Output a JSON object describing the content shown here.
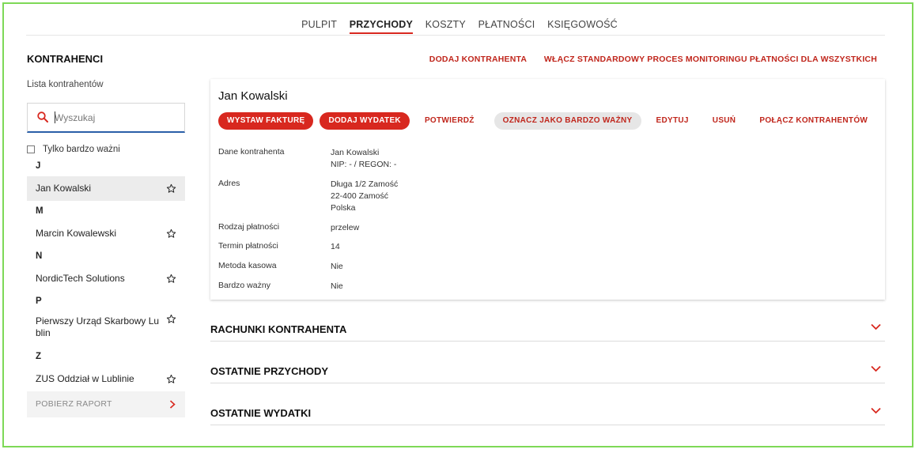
{
  "nav": {
    "tabs": [
      "PULPIT",
      "PRZYCHODY",
      "KOSZTY",
      "PŁATNOŚCI",
      "KSIĘGOWOŚĆ"
    ],
    "active": "PRZYCHODY"
  },
  "sidebar": {
    "title": "KONTRAHENCI",
    "list_label": "Lista kontrahentów",
    "search": {
      "placeholder": "Wyszukaj",
      "value": ""
    },
    "only_important_label": "Tylko bardzo ważni",
    "groups": [
      {
        "letter": "J",
        "items": [
          {
            "name": "Jan Kowalski",
            "selected": true
          }
        ]
      },
      {
        "letter": "M",
        "items": [
          {
            "name": "Marcin Kowalewski"
          }
        ]
      },
      {
        "letter": "N",
        "items": [
          {
            "name": "NordicTech Solutions"
          }
        ]
      },
      {
        "letter": "P",
        "items": [
          {
            "name": "Pierwszy Urząd Skarbowy Lublin",
            "wrap": true
          }
        ]
      },
      {
        "letter": "Z",
        "items": [
          {
            "name": "ZUS Oddział w Lublinie"
          }
        ]
      }
    ],
    "report_label": "POBIERZ RAPORT"
  },
  "top_actions": {
    "add": "DODAJ KONTRAHENTA",
    "monitor": "WŁĄCZ STANDARDOWY PROCES MONITORINGU PŁATNOŚCI DLA WSZYSTKICH"
  },
  "detail": {
    "name": "Jan Kowalski",
    "actions": {
      "invoice": "WYSTAW FAKTURĘ",
      "expense": "DODAJ WYDATEK",
      "confirm": "POTWIERDŹ",
      "important": "OZNACZ JAKO BARDZO WAŻNY",
      "edit": "EDYTUJ",
      "delete": "USUŃ",
      "merge": "POŁĄCZ KONTRAHENTÓW"
    },
    "fields": [
      {
        "label": "Dane kontrahenta",
        "lines": [
          "Jan Kowalski",
          "NIP: - / REGON: -"
        ]
      },
      {
        "label": "Adres",
        "lines": [
          "Długa 1/2 Zamość",
          "22-400 Zamość",
          "Polska"
        ]
      },
      {
        "label": "Rodzaj płatności",
        "lines": [
          "przelew"
        ]
      },
      {
        "label": "Termin płatności",
        "lines": [
          "14"
        ]
      },
      {
        "label": "Metoda kasowa",
        "lines": [
          "Nie"
        ]
      },
      {
        "label": "Bardzo ważny",
        "lines": [
          "Nie"
        ]
      }
    ]
  },
  "sections": [
    "RACHUNKI KONTRAHENTA",
    "OSTATNIE PRZYCHODY",
    "OSTATNIE WYDATKI"
  ],
  "colors": {
    "accent": "#d8281f",
    "frame": "#7ed957",
    "input_underline": "#2a5fa8"
  }
}
